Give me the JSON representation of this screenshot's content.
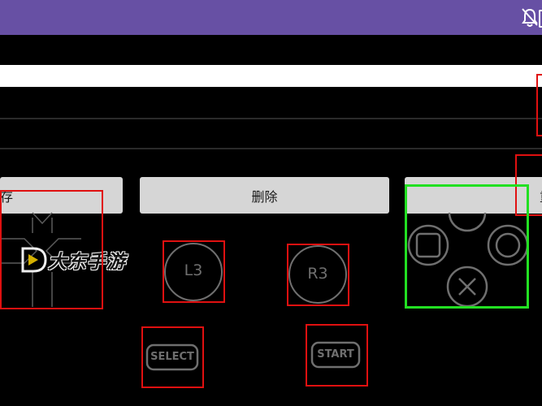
{
  "colors": {
    "status_bar": "#6750a4",
    "button_bg": "#d6d6d6",
    "red_outline": "#e01010",
    "green_outline": "#22e022",
    "control_gray": "#6f6f6f"
  },
  "status_bar": {
    "icons": [
      "bell-off-icon",
      "battery-icon"
    ]
  },
  "buttons": {
    "save_label": "存",
    "delete_label": "删除",
    "reset_label": "重置"
  },
  "controls": {
    "l3_label": "L3",
    "r3_label": "R3",
    "select_label": "SELECT",
    "start_label": "START"
  },
  "watermark": {
    "text": "大东手游"
  }
}
